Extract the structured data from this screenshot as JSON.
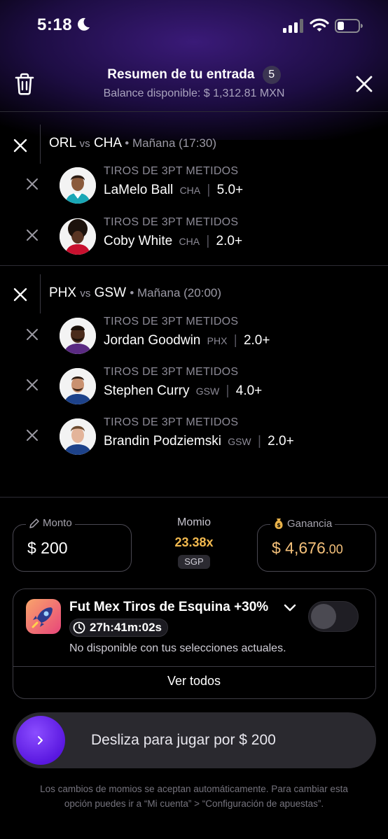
{
  "status_bar": {
    "time": "5:18"
  },
  "header": {
    "title": "Resumen de tu entrada",
    "count": "5",
    "balance": "Balance disponible: $ 1,312.81 MXN"
  },
  "games": [
    {
      "team_a": "ORL",
      "vs": "vs",
      "team_b": "CHA",
      "when": "• Mañana (17:30)",
      "legs": [
        {
          "market": "TIROS DE 3PT METIDOS",
          "player": "LaMelo Ball",
          "team": "CHA",
          "sep": "|",
          "line": "5.0+"
        },
        {
          "market": "TIROS DE 3PT METIDOS",
          "player": "Coby White",
          "team": "CHA",
          "sep": "|",
          "line": "2.0+"
        }
      ]
    },
    {
      "team_a": "PHX",
      "vs": "vs",
      "team_b": "GSW",
      "when": "• Mañana (20:00)",
      "legs": [
        {
          "market": "TIROS DE 3PT METIDOS",
          "player": "Jordan Goodwin",
          "team": "PHX",
          "sep": "|",
          "line": "2.0+"
        },
        {
          "market": "TIROS DE 3PT METIDOS",
          "player": "Stephen Curry",
          "team": "GSW",
          "sep": "|",
          "line": "4.0+"
        },
        {
          "market": "TIROS DE 3PT METIDOS",
          "player": "Brandin Podziemski",
          "team": "GSW",
          "sep": "|",
          "line": "2.0+"
        }
      ]
    }
  ],
  "bet": {
    "amount_label": "Monto",
    "amount_value": "$ 200",
    "odds_label": "Momio",
    "odds_value": "23.38x",
    "odds_tag": "SGP",
    "win_label": "Ganancia",
    "win_main": "$ 4,676",
    "win_decimals": ".00"
  },
  "promo": {
    "title": "Fut Mex Tiros de Esquina +30%",
    "timer": "27h:41m:02s",
    "note": "No disponible con tus selecciones actuales.",
    "see_all": "Ver todos",
    "enabled": false
  },
  "slider": {
    "label": "Desliza para jugar por $ 200"
  },
  "footer": {
    "line1": "Los cambios de momios se aceptan automáticamente. Para cambiar esta",
    "line2": "opción puedes ir a “Mi cuenta” > “Configuración de apuestas”."
  },
  "colors": {
    "accent_purple": "#5a18e0",
    "odds_gold": "#f2b94f",
    "win_gold": "#f4c07a",
    "header_glow": "#3a1a78"
  },
  "icons": [
    "moon-icon",
    "signal-icon",
    "wifi-icon",
    "battery-icon",
    "trash-icon",
    "close-icon",
    "remove-icon",
    "pencil-icon",
    "money-bag-icon",
    "rocket-icon",
    "chevron-down-icon",
    "clock-icon",
    "chevron-right-icon"
  ]
}
